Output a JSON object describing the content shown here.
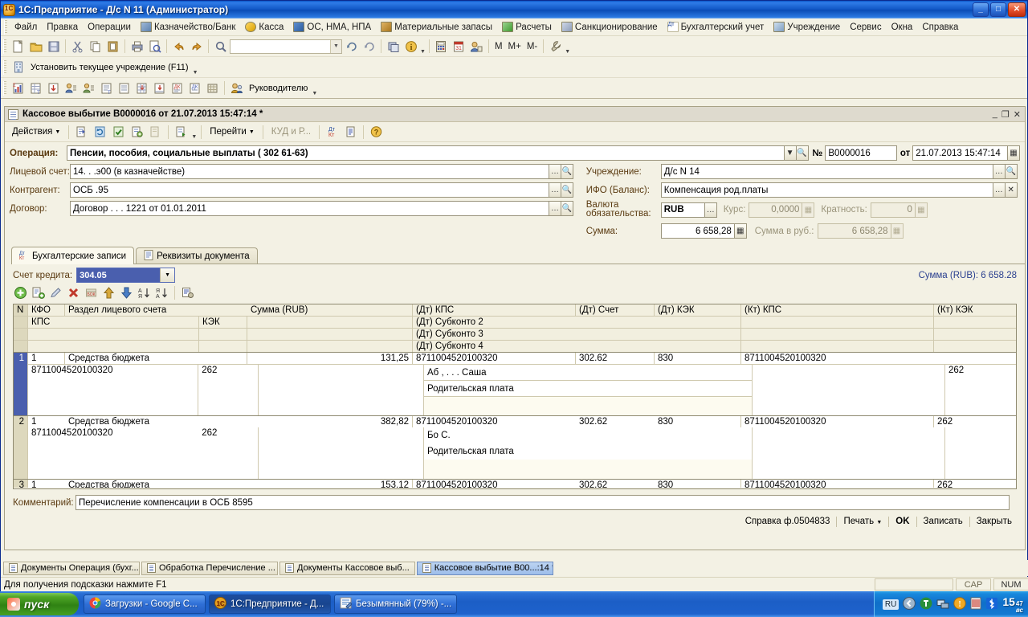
{
  "window": {
    "title": "1С:Предприятие - Д/с N 11 (Администратор)",
    "minimize": "_",
    "maximize": "□",
    "close": "✕"
  },
  "menu": [
    {
      "label": "Файл",
      "icon": null
    },
    {
      "label": "Правка",
      "icon": null
    },
    {
      "label": "Операции",
      "icon": null
    },
    {
      "label": "Казначейство/Банк",
      "icon": "bank-icon"
    },
    {
      "label": "Касса",
      "icon": "cash-icon"
    },
    {
      "label": "ОС, НМА, НПА",
      "icon": "assets-icon"
    },
    {
      "label": "Материальные запасы",
      "icon": "materials-icon"
    },
    {
      "label": "Расчеты",
      "icon": "settlements-icon"
    },
    {
      "label": "Санкционирование",
      "icon": "sanction-icon"
    },
    {
      "label": "Бухгалтерский учет",
      "icon": "accounting-icon"
    },
    {
      "label": "Учреждение",
      "icon": "institution-icon"
    },
    {
      "label": "Сервис",
      "icon": null
    },
    {
      "label": "Окна",
      "icon": null
    },
    {
      "label": "Справка",
      "icon": null
    }
  ],
  "toolbar_main": {
    "search_value": "",
    "buttons": [
      "new-document-icon",
      "open-folder-icon",
      "save-icon",
      "cut-icon",
      "copy-icon",
      "paste-icon",
      "print-icon",
      "print-preview-icon",
      "undo-icon",
      "redo-icon",
      "find-icon"
    ],
    "buttons_right": [
      "refresh-search-icon",
      "clear-search-icon",
      "copy-window-icon",
      "info-icon",
      "calculator-icon",
      "calendar-icon",
      "user-icon"
    ],
    "m_labels": [
      "M",
      "M+",
      "M-"
    ],
    "settings_icon": "wrench-icon"
  },
  "toolbar_institution": {
    "label": "Установить текущее учреждение (F11)",
    "icon": "institution-icon"
  },
  "toolbar_reports": {
    "icons": [
      "turnover-balance-icon",
      "turnover-account-icon",
      "account-card-icon",
      "subconto-analysis-icon",
      "subconto-card-icon",
      "journal-order-icon",
      "general-ledger-icon",
      "chess-sheet-icon",
      "account-analysis-icon",
      "dk-report-icon",
      "dk-card-icon",
      "report-grid-icon"
    ],
    "manager_label": "Руководителю",
    "manager_icon": "manager-icon"
  },
  "document": {
    "title": "Кассовое выбытие B0000016 от 21.07.2013 15:47:14 *",
    "titlebar_buttons": {
      "minimize": "_",
      "restore": "❐",
      "close": "✕"
    },
    "toolbar": {
      "actions_label": "Действия",
      "goto_label": "Перейти",
      "kud_label": "КУД и Р...",
      "icons": [
        "post-and-close-icon",
        "repost-icon",
        "post-icon",
        "fill-icon",
        "clear-icon",
        "structure-icon",
        "accounting-entries-icon",
        "register-records-icon",
        "help-icon"
      ]
    },
    "fields": {
      "operation_label": "Операция:",
      "operation_value": "Пенсии, пособия, социальные выплаты ( 302 61-63)",
      "number_label": "№",
      "number_value": "B0000016",
      "date_label": "от",
      "date_value": "21.07.2013 15:47:14",
      "personal_account_label": "Лицевой счет:",
      "personal_account_value": "14.   .  .э00 (в казначействе)",
      "counterparty_label": "Контрагент:",
      "counterparty_value": "ОСБ  .95",
      "contract_label": "Договор:",
      "contract_value": "Договор   . . .  1221 от 01.01.2011",
      "institution_label": "Учреждение:",
      "institution_value": "Д/с N 14",
      "ifo_label": "ИФО (Баланс):",
      "ifo_value": "Компенсация род.платы",
      "currency_label": "Валюта обязательства:",
      "currency_value": "RUB",
      "rate_label": "Курс:",
      "rate_value": "0,0000",
      "multiplicity_label": "Кратность:",
      "multiplicity_value": "0",
      "sum_label": "Сумма:",
      "sum_value": "6 658,28",
      "sum_rub_label": "Сумма в руб.:",
      "sum_rub_value": "6 658,28"
    },
    "tabs": [
      {
        "label": "Бухгалтерские записи",
        "active": true,
        "icon": "accounting-icon"
      },
      {
        "label": "Реквизиты документа",
        "active": false,
        "icon": "document-icon"
      }
    ],
    "credit_account_label": "Счет кредита:",
    "credit_account_value": "304.05",
    "total_label": "Сумма (RUB): 6 658.28",
    "grid_toolbar_icons": [
      "add-row-icon",
      "copy-row-icon",
      "edit-row-icon",
      "delete-row-icon",
      "delete-direct-icon",
      "move-up-icon",
      "move-down-icon",
      "sort-asc-icon",
      "sort-desc-icon",
      "setup-list-icon"
    ],
    "comment_label": "Комментарий:",
    "comment_value": "Перечисление компенсации в ОСБ 8595",
    "footer_buttons": [
      {
        "label": "Справка ф.0504833",
        "bold": false
      },
      {
        "label": "Печать",
        "bold": false,
        "caret": true
      },
      {
        "label": "OK",
        "bold": true
      },
      {
        "label": "Записать",
        "bold": false
      },
      {
        "label": "Закрыть",
        "bold": false
      }
    ]
  },
  "grid": {
    "headers_line1": [
      "N",
      "КФО",
      "Раздел лицевого счета",
      "Сумма (RUB)",
      "(Дт) КПС",
      "(Дт) Счет",
      "(Дт) КЭК",
      "(Кт) КПС",
      "(Кт) КЭК"
    ],
    "headers_sub": [
      "КПС",
      "КЭК",
      "(Дт) Субконто 2",
      "(Дт) Субконто 3",
      "(Дт) Субконто 4"
    ],
    "rows": [
      {
        "n": "1",
        "kfo": "1",
        "razdel": "Средства бюджета",
        "kps": "8711004520100320",
        "kek": "262",
        "summa": "131,25",
        "dt_kps": "8711004520100320",
        "dt_schet": "302.62",
        "dt_kek": "830",
        "dt_sub2": "Аб  , . . .     Саша",
        "dt_sub3": "Родительская плата",
        "dt_sub4": "",
        "kt_kps": "8711004520100320",
        "kt_kek": "262",
        "selected": true
      },
      {
        "n": "2",
        "kfo": "1",
        "razdel": "Средства бюджета",
        "kps": "8711004520100320",
        "kek": "262",
        "summa": "382,82",
        "dt_kps": "8711004520100320",
        "dt_schet": "302.62",
        "dt_kek": "830",
        "dt_sub2": "Бо          С.",
        "dt_sub3": "Родительская плата",
        "dt_sub4": "",
        "kt_kps": "8711004520100320",
        "kt_kek": "262",
        "selected": false
      },
      {
        "n": "3",
        "kfo": "1",
        "razdel": "Средства бюджета",
        "kps": "",
        "kek": "",
        "summa": "153,12",
        "dt_kps": "8711004520100320",
        "dt_schet": "302.62",
        "dt_kek": "830",
        "dt_sub2": "",
        "dt_sub3": "",
        "dt_sub4": "",
        "kt_kps": "8711004520100320",
        "kt_kek": "262",
        "selected": false
      }
    ]
  },
  "window_tabs": [
    {
      "label": "Документы Операция (бухг...",
      "active": false
    },
    {
      "label": "Обработка  Перечисление ...",
      "active": false
    },
    {
      "label": "Документы Кассовое выб...",
      "active": false
    },
    {
      "label": "Кассовое выбытие B00...:14 *",
      "active": true
    }
  ],
  "statusbar": {
    "hint": "Для получения подсказки нажмите F1",
    "cap": "CAP",
    "num": "NUM"
  },
  "taskbar": {
    "start_label": "пуск",
    "items": [
      {
        "label": "Загрузки - Google C...",
        "active": false,
        "icon": "chrome-icon"
      },
      {
        "label": "1С:Предприятие - Д...",
        "active": true,
        "icon": "1c-icon"
      },
      {
        "label": "Безымянный (79%) -...",
        "active": false,
        "icon": "editor-icon"
      }
    ],
    "tray": {
      "language": "RU",
      "icons": [
        "back-arrow-icon",
        "utorrent-icon",
        "network-icon",
        "update-icon",
        "barcode-icon",
        "bluetooth-icon"
      ],
      "clock_hours": "15",
      "clock_minutes": "47",
      "clock_suffix": "вс"
    }
  },
  "colors": {
    "accent": "#4a5fae",
    "form_bg": "#f3f1e4",
    "title_blue": "#1157c6",
    "total_text": "#2a3f8f"
  }
}
